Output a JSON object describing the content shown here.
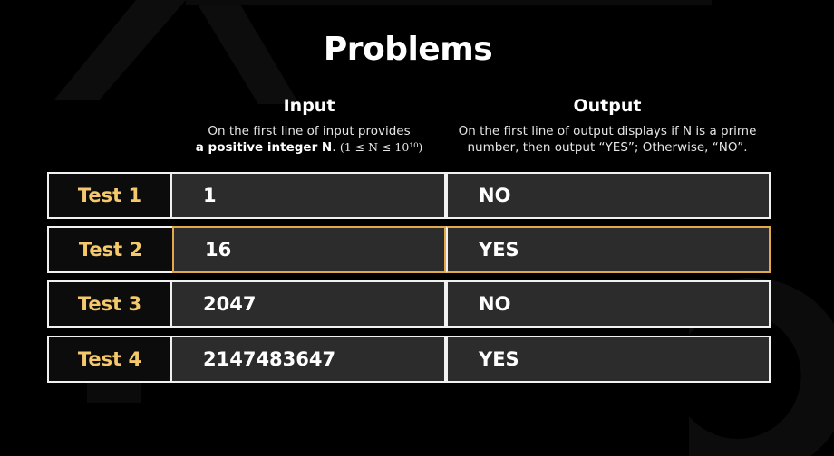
{
  "title": "Problems",
  "input": {
    "heading": "Input",
    "line1": "On the first line of input provides",
    "line2_bold": "a positive integer N",
    "line2_rest": ". ",
    "constraint": "(1 ≤ N ≤ 10¹⁰)"
  },
  "output": {
    "heading": "Output",
    "line1": "On the first line of output displays if N is a prime",
    "line2": "number, then output “YES”; Otherwise, “NO”."
  },
  "tests": [
    {
      "label": "Test 1",
      "input": "1",
      "output": "NO",
      "highlighted": false
    },
    {
      "label": "Test 2",
      "input": "16",
      "output": "YES",
      "highlighted": true
    },
    {
      "label": "Test 3",
      "input": "2047",
      "output": "NO",
      "highlighted": false
    },
    {
      "label": "Test 4",
      "input": "2147483647",
      "output": "YES",
      "highlighted": false
    }
  ],
  "colors": {
    "background": "#000000",
    "cell": "#2c2c2c",
    "label_text": "#f5c96b",
    "highlight_border": "#e3a84a"
  }
}
